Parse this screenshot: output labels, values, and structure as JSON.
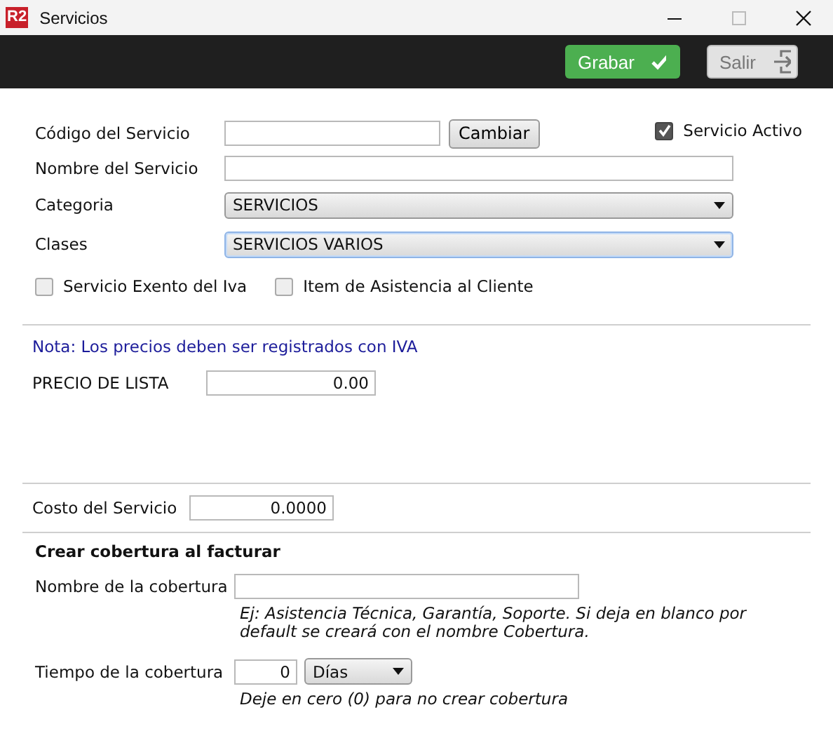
{
  "window": {
    "title": "Servicios",
    "logo": "R2"
  },
  "toolbar": {
    "buttons": [
      {
        "label": "Grabar",
        "kind": "save"
      },
      {
        "label": "Salir",
        "kind": "exit"
      }
    ]
  },
  "general": {
    "code_label": "Código del Servicio",
    "change_button": "Cambiar",
    "active": {
      "label": "Servicio Activo",
      "checked": true
    },
    "name_label": "Nombre del Servicio",
    "selects": [
      {
        "label": "Categoria",
        "value": "SERVICIOS",
        "focused": false
      },
      {
        "label": "Clases",
        "value": "SERVICIOS VARIOS",
        "focused": true
      }
    ],
    "options": [
      {
        "label": "Servicio Exento del Iva",
        "checked": false
      },
      {
        "label": "Item de Asistencia al Cliente",
        "checked": false
      }
    ]
  },
  "prices": {
    "note": "Nota: Los precios deben ser registrados con IVA",
    "list_price": {
      "label": "PRECIO DE LISTA",
      "value": "0.00"
    }
  },
  "cost": {
    "label": "Costo del Servicio",
    "value": "0.0000"
  },
  "coverage": {
    "title": "Crear cobertura al facturar",
    "name_label": "Nombre de la cobertura",
    "name_hint": "Ej: Asistencia Técnica, Garantía, Soporte. Si deja en blanco por default se creará con el nombre Cobertura.",
    "time_label": "Tiempo de la cobertura",
    "time_value": "0",
    "unit": "Días",
    "time_hint": "Deje en cero (0) para no crear cobertura"
  }
}
